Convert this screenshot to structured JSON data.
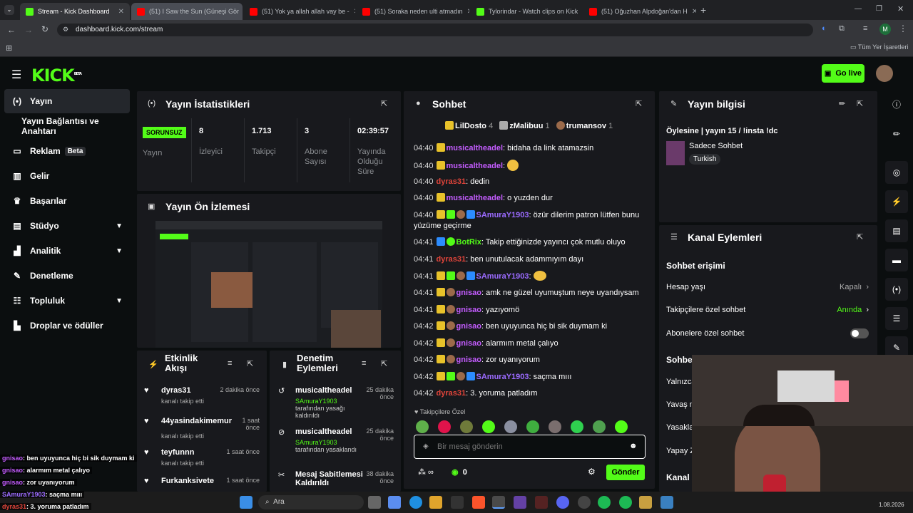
{
  "browser": {
    "tabs": [
      {
        "title": "Stream - Kick Dashboard",
        "fav": "kick"
      },
      {
        "title": "(51) I Saw the Sun (Güneşi Gör",
        "fav": "youtube"
      },
      {
        "title": "(51) Yok ya allah allah vay be -",
        "fav": "youtube"
      },
      {
        "title": "(51) Soraka neden ulti atmadın",
        "fav": "youtube"
      },
      {
        "title": "Tylorindar - Watch clips on Kick",
        "fav": "kick"
      },
      {
        "title": "(51) Oğuzhan Alpdoğan'dan H",
        "fav": "youtube"
      }
    ],
    "url": "dashboard.kick.com/stream",
    "bookmarks_label": "Tüm Yer İşaretleri",
    "profile_initial": "M"
  },
  "kick": {
    "logo": "KICK",
    "logo_badge": "BETA",
    "go_live": "Go live"
  },
  "sidebar": [
    {
      "label": "Yayın",
      "icon": "broadcast-icon"
    },
    {
      "label": "Yayın Bağlantısı ve Anahtarı",
      "icon": ""
    },
    {
      "label": "Reklam",
      "icon": "ad-icon",
      "badge": "Beta"
    },
    {
      "label": "Gelir",
      "icon": "chart-icon"
    },
    {
      "label": "Başarılar",
      "icon": "trophy-icon"
    },
    {
      "label": "Stüdyo",
      "icon": "studio-icon"
    },
    {
      "label": "Analitik",
      "icon": "analytics-icon"
    },
    {
      "label": "Denetleme",
      "icon": "wrench-icon"
    },
    {
      "label": "Topluluk",
      "icon": "community-icon"
    },
    {
      "label": "Droplar ve ödüller",
      "icon": "drops-icon"
    }
  ],
  "stats": {
    "title": "Yayın İstatistikleri",
    "status_badge": "SORUNSUZ",
    "status_label": "Yayın",
    "viewers": "8",
    "viewers_label": "İzleyici",
    "followers": "1.713",
    "followers_label": "Takipçi",
    "subs": "3",
    "subs_label": "Abone Sayısı",
    "uptime": "02:39:57",
    "uptime_label": "Yayında Olduğu Süre"
  },
  "preview": {
    "title": "Yayın Ön İzlemesi"
  },
  "activity": {
    "title": "Etkinlik Akışı",
    "items": [
      {
        "name": "dyras31",
        "sub": "kanalı takip etti",
        "time": "2 dakika önce"
      },
      {
        "name": "44yasindakimemur",
        "sub": "kanalı takip etti",
        "time": "1 saat önce"
      },
      {
        "name": "teyfunnn",
        "sub": "kanalı takip etti",
        "time": "1 saat önce"
      },
      {
        "name": "Furkanksivete",
        "sub": "",
        "time": "1 saat önce"
      }
    ]
  },
  "moderation": {
    "title": "Denetim Eylemleri",
    "items": [
      {
        "name": "musicaltheadel",
        "sub_user": "SAmuraY1903",
        "sub": "tarafından yasağı kaldırıldı",
        "time": "25 dakika önce"
      },
      {
        "name": "musicaltheadel",
        "sub_user": "SAmuraY1903",
        "sub": "tarafından yasaklandı",
        "time": "25 dakika önce"
      },
      {
        "name": "Mesaj Sabitlemesi Kaldırıldı",
        "sub_user": "",
        "sub": "",
        "time": "38 dakika önce"
      }
    ]
  },
  "chat": {
    "title": "Sohbet",
    "top": [
      {
        "name": "LilDosto",
        "count": "4"
      },
      {
        "name": "zMalibuu",
        "count": "1"
      },
      {
        "name": "trumansov",
        "count": "1"
      }
    ],
    "messages": [
      {
        "time": "04:40",
        "user": "musicaltheadel",
        "color": "#c45cff",
        "text": "bidaha da link atamazsin"
      },
      {
        "time": "04:40",
        "user": "musicaltheadel",
        "color": "#c45cff",
        "text": ""
      },
      {
        "time": "04:40",
        "user": "dyras31",
        "color": "#e0443a",
        "text": "dedin"
      },
      {
        "time": "04:40",
        "user": "musicaltheadel",
        "color": "#c45cff",
        "text": "o yuzden dur"
      },
      {
        "time": "04:40",
        "user": "SAmuraY1903",
        "color": "#9b6bff",
        "text": "özür dilerim patron lütfen bunu yüzüme geçirme"
      },
      {
        "time": "04:41",
        "user": "BotRix",
        "color": "#53fc18",
        "text": "Takip ettiğinizde yayıncı çok mutlu oluyo"
      },
      {
        "time": "04:41",
        "user": "dyras31",
        "color": "#e0443a",
        "text": "ben unutulacak adammıyım dayı"
      },
      {
        "time": "04:41",
        "user": "SAmuraY1903",
        "color": "#9b6bff",
        "text": ""
      },
      {
        "time": "04:41",
        "user": "gnisao",
        "color": "#c45cff",
        "text": "amk ne güzel uyumuştum neye uyandıysam"
      },
      {
        "time": "04:41",
        "user": "gnisao",
        "color": "#c45cff",
        "text": "yazıyomö"
      },
      {
        "time": "04:42",
        "user": "gnisao",
        "color": "#c45cff",
        "text": "ben uyuyunca hiç bi sik duymam ki"
      },
      {
        "time": "04:42",
        "user": "gnisao",
        "color": "#c45cff",
        "text": "alarmım metal çalıyo"
      },
      {
        "time": "04:42",
        "user": "gnisao",
        "color": "#c45cff",
        "text": "zor uyanıyorum"
      },
      {
        "time": "04:42",
        "user": "SAmuraY1903",
        "color": "#9b6bff",
        "text": "saçma mııı"
      },
      {
        "time": "04:42",
        "user": "dyras31",
        "color": "#e0443a",
        "text": "3. yoruma patladım"
      }
    ],
    "followers_only": "Takipçilere Özel",
    "placeholder": "Bir mesaj gönderin",
    "points": "0",
    "send": "Gönder"
  },
  "streaminfo": {
    "title": "Yayın bilgisi",
    "stream_title": "Öylesine | yayın 15 / !insta !dc",
    "category": "Sadece Sohbet",
    "tag": "Turkish"
  },
  "channel": {
    "title": "Kanal Eylemleri",
    "section": "Sohbet erişimi",
    "rows": [
      {
        "label": "Hesap yaşı",
        "value": "Kapalı"
      },
      {
        "label": "Takipçilere özel sohbet",
        "value": "Anında"
      },
      {
        "label": "Abonelere özel sohbet",
        "value": ""
      }
    ],
    "section2": "Sohbe",
    "partial": [
      "Yalnızca",
      "Yavaş m",
      "Yasakla",
      "Yapay Z"
    ],
    "kanal": "Kanal"
  },
  "overlay_chat": [
    {
      "user": "gnisao",
      "text": ": ben uyuyunca hiç bi sik duymam ki"
    },
    {
      "user": "gnisao",
      "text": ": alarmım metal çalıyo"
    },
    {
      "user": "gnisao",
      "text": ": zor uyanıyorum"
    },
    {
      "user": "SAmuraY1903",
      "text": ": saçma mııı"
    },
    {
      "user": "dyras31",
      "text": ": 3. yoruma patladım"
    }
  ],
  "taskbar": {
    "search": "Ara",
    "date": "1.08.2026"
  }
}
